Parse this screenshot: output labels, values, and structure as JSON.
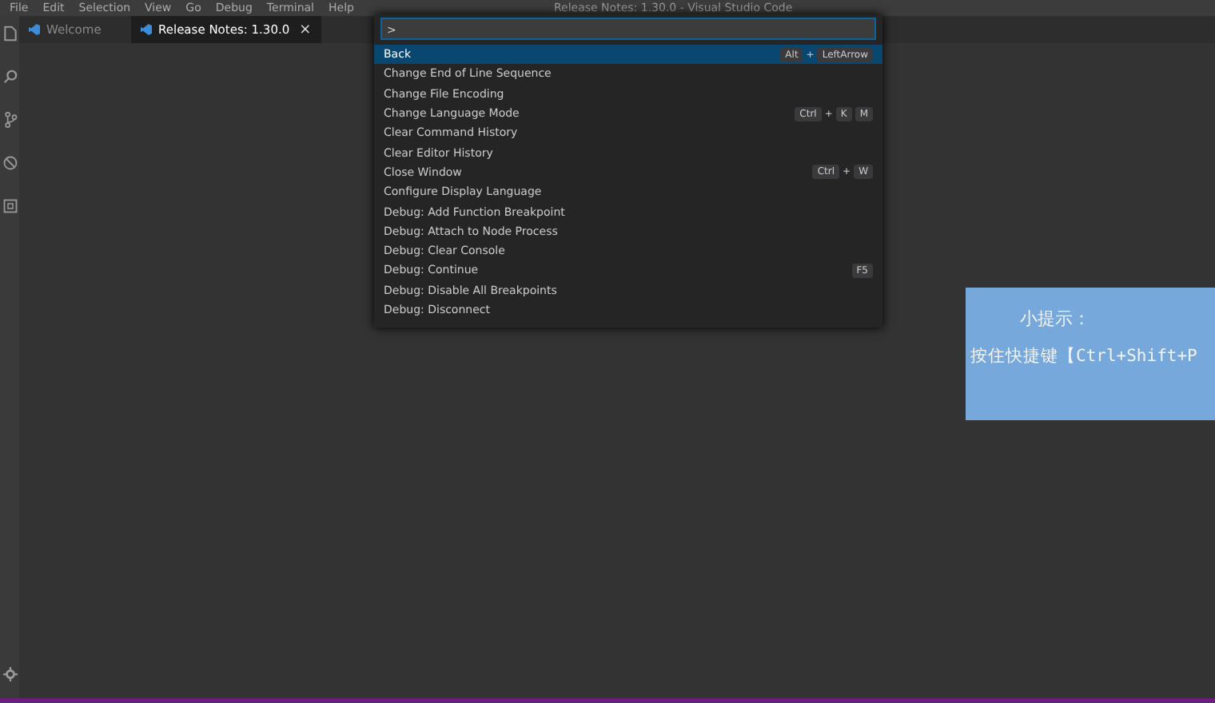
{
  "menu_bar": {
    "items": [
      "File",
      "Edit",
      "Selection",
      "View",
      "Go",
      "Debug",
      "Terminal",
      "Help"
    ],
    "title": "Release Notes: 1.30.0 - Visual Studio Code"
  },
  "tabs": [
    {
      "label": "Welcome",
      "selected": false
    },
    {
      "label": "Release Notes: 1.30.0",
      "selected": true,
      "close": "×"
    }
  ],
  "command_palette": {
    "value": ">",
    "items": [
      {
        "label": "Back",
        "selected": true,
        "keys": [
          {
            "kind": "key",
            "label": "Alt"
          },
          {
            "kind": "sep",
            "label": "+"
          },
          {
            "kind": "key",
            "label": "LeftArrow"
          }
        ]
      },
      {
        "label": "Change End of Line Sequence",
        "selected": false
      },
      {
        "label": "Change File Encoding",
        "selected": false
      },
      {
        "label": "Change Language Mode",
        "selected": false,
        "keys": [
          {
            "kind": "key",
            "label": "Ctrl"
          },
          {
            "kind": "sep",
            "label": "+"
          },
          {
            "kind": "key",
            "label": "K"
          },
          {
            "kind": "key",
            "label": "M"
          }
        ]
      },
      {
        "label": "Clear Command History",
        "selected": false
      },
      {
        "label": "Clear Editor History",
        "selected": false
      },
      {
        "label": "Close Window",
        "selected": false,
        "keys": [
          {
            "kind": "key",
            "label": "Ctrl"
          },
          {
            "kind": "sep",
            "label": "+"
          },
          {
            "kind": "key",
            "label": "W"
          }
        ]
      },
      {
        "label": "Configure Display Language",
        "selected": false
      },
      {
        "label": "Debug: Add Function Breakpoint",
        "selected": false
      },
      {
        "label": "Debug: Attach to Node Process",
        "selected": false
      },
      {
        "label": "Debug: Clear Console",
        "selected": false
      },
      {
        "label": "Debug: Continue",
        "selected": false,
        "keys": [
          {
            "kind": "key",
            "label": "F5"
          }
        ]
      },
      {
        "label": "Debug: Disable All Breakpoints",
        "selected": false
      },
      {
        "label": "Debug: Disconnect",
        "selected": false
      }
    ]
  },
  "tip": {
    "title": "小提示：",
    "text": "按住快捷键【Ctrl+Shift+P"
  }
}
